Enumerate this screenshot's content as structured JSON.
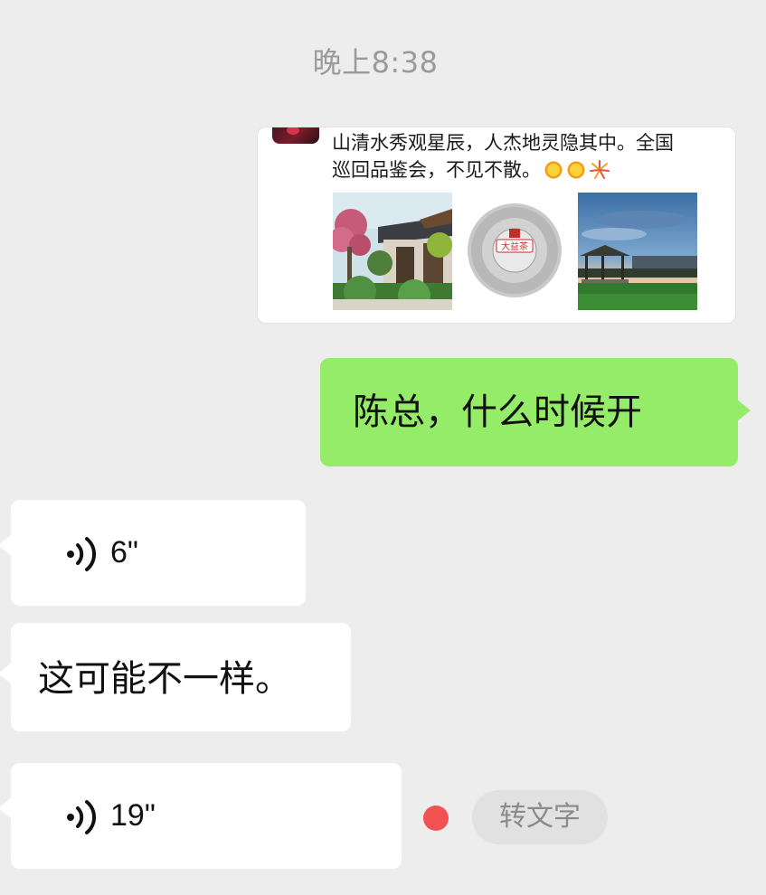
{
  "chat": {
    "timestamp": "晚上8:38",
    "moment_card": {
      "text_line1": "山清水秀观星辰，人杰地灵隐其中。全国",
      "text_line2": "巡回品鉴会，不见不散。",
      "emoji": [
        "sun-emoji",
        "sun-emoji",
        "firework-emoji"
      ],
      "images": [
        "garden-image",
        "tea-cake-image",
        "pavilion-image"
      ],
      "tea_cake_label": "大益茶"
    },
    "outgoing_message": "陈总，什么时候开",
    "incoming_voice_1": {
      "duration": "6\""
    },
    "incoming_text": "这可能不一样。",
    "incoming_voice_2": {
      "duration": "19\"",
      "unread_dot_color": "#f15151",
      "to_text_label": "转文字"
    }
  },
  "colors": {
    "background": "#ededed",
    "outgoing_bubble": "#95ec69",
    "incoming_bubble": "#ffffff",
    "timestamp": "#9a9a9a"
  }
}
